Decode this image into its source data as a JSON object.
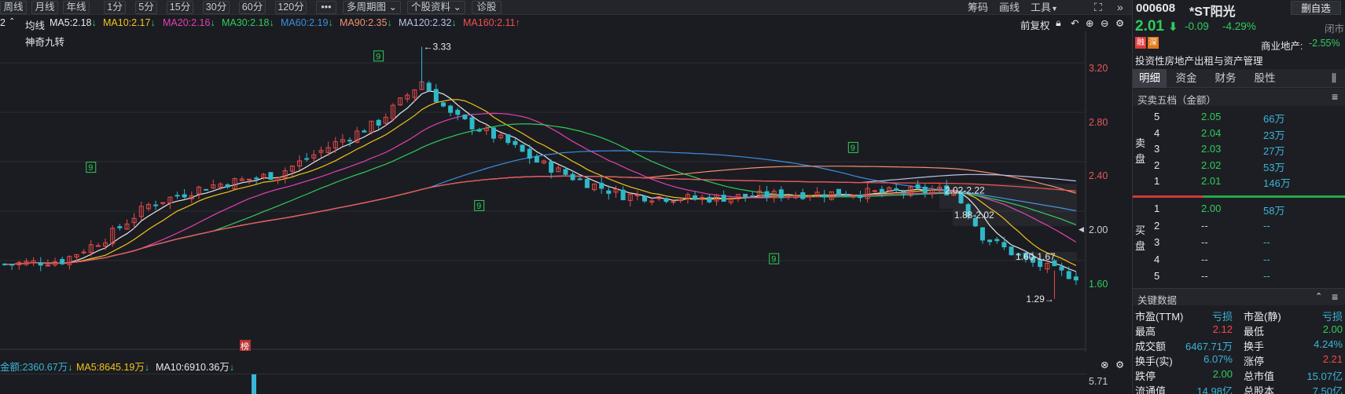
{
  "toolbar": {
    "items": [
      "周线",
      "月线",
      "年线",
      "1分",
      "5分",
      "15分",
      "30分",
      "60分",
      "120分",
      "•••",
      "多周期图",
      "个股资料",
      "诊股"
    ],
    "right_items": [
      "筹码",
      "画线",
      "工具"
    ],
    "fullscreen_icon": "expand-icon",
    "collapse_icon": "double-chevron-right-icon"
  },
  "ma_row": {
    "prefix": "2",
    "prefix_arrow": "^",
    "avg_label": "均线",
    "items": [
      {
        "text": "MA5:2.18",
        "arrow": "↓",
        "color": "#e6e8ec"
      },
      {
        "text": "MA10:2.17",
        "arrow": "↓",
        "color": "#f0c419"
      },
      {
        "text": "MA20:2.16",
        "arrow": "↓",
        "color": "#e040b0"
      },
      {
        "text": "MA30:2.18",
        "arrow": "↓",
        "color": "#2ecc5b"
      },
      {
        "text": "MA60:2.19",
        "arrow": "↓",
        "color": "#3a8fe0"
      },
      {
        "text": "MA90:2.35",
        "arrow": "↓",
        "color": "#f09070"
      },
      {
        "text": "MA120:2.32",
        "arrow": "↓",
        "color": "#b8c0e8"
      },
      {
        "text": "MA160:2.11",
        "arrow": "↑",
        "color": "#f05050"
      }
    ],
    "fuquan": "前复权"
  },
  "chart": {
    "indicator_label": "神奇九转",
    "y_ticks": [
      "3.20",
      "2.80",
      "2.40",
      "2.00",
      "1.60"
    ],
    "annotations": {
      "high": "←3.33",
      "low": "1.29→",
      "zone1": "2.02-2.22",
      "zone2": "1.88-2.02",
      "zone3": "1.60-1.67"
    },
    "tag_bang": "榜",
    "nine_marker": "9"
  },
  "chart_data": {
    "type": "candlestick",
    "title": "",
    "y_ticks": [
      3.2,
      2.8,
      2.4,
      2.0,
      1.6
    ],
    "ylim": [
      1.25,
      3.45
    ],
    "high": 3.33,
    "low": 1.29,
    "series": [
      {
        "name": "MA5",
        "last": 2.18
      },
      {
        "name": "MA10",
        "last": 2.17
      },
      {
        "name": "MA20",
        "last": 2.16
      },
      {
        "name": "MA30",
        "last": 2.18
      },
      {
        "name": "MA60",
        "last": 2.19
      },
      {
        "name": "MA90",
        "last": 2.35
      },
      {
        "name": "MA120",
        "last": 2.32
      },
      {
        "name": "MA160",
        "last": 2.11
      }
    ]
  },
  "volume": {
    "items": [
      {
        "text": "金额:2360.67万",
        "arrow": "↓",
        "color": "#38b6d8"
      },
      {
        "text": "MA5:8645.19万",
        "arrow": "↓",
        "color": "#f0c419"
      },
      {
        "text": "MA10:6910.36万",
        "arrow": "↓",
        "color": "#e6e8ec"
      }
    ],
    "tick": "5.71"
  },
  "stock": {
    "code": "000608",
    "name": "*ST阳光",
    "delete_btn": "删自选",
    "price": "2.01",
    "change": "-0.09",
    "change_pct": "-4.29%",
    "status": "闭市",
    "badge_rz": "融",
    "badge_shen": "深",
    "industry": "商业地产:",
    "industry_pct": "-2.55%",
    "business": "投资性房地产出租与资产管理"
  },
  "tabs": [
    "明细",
    "资金",
    "财务",
    "股性"
  ],
  "orderbook": {
    "title": "买卖五档（金额）",
    "sell_label": "卖盘",
    "buy_label": "买盘",
    "sells": [
      {
        "level": "5",
        "price": "2.05",
        "amount": "66万"
      },
      {
        "level": "4",
        "price": "2.04",
        "amount": "23万"
      },
      {
        "level": "3",
        "price": "2.03",
        "amount": "27万"
      },
      {
        "level": "2",
        "price": "2.02",
        "amount": "53万"
      },
      {
        "level": "1",
        "price": "2.01",
        "amount": "146万"
      }
    ],
    "buys": [
      {
        "level": "1",
        "price": "2.00",
        "amount": "58万"
      },
      {
        "level": "2",
        "price": "--",
        "amount": "--"
      },
      {
        "level": "3",
        "price": "--",
        "amount": "--"
      },
      {
        "level": "4",
        "price": "--",
        "amount": "--"
      },
      {
        "level": "5",
        "price": "--",
        "amount": "--"
      }
    ]
  },
  "keydata": {
    "title": "关键数据",
    "rows": [
      {
        "l1": "市盈(TTM)",
        "v1": "亏损",
        "c1": "#38b6d8",
        "l2": "市盈(静)",
        "v2": "亏损",
        "c2": "#38b6d8"
      },
      {
        "l1": "最高",
        "v1": "2.12",
        "c1": "#f04848",
        "l2": "最低",
        "v2": "2.00",
        "c2": "#2ecc5b"
      },
      {
        "l1": "成交额",
        "v1": "6467.71万",
        "c1": "#38b6d8",
        "l2": "换手",
        "v2": "4.24%",
        "c2": "#38b6d8"
      },
      {
        "l1": "换手(实)",
        "v1": "6.07%",
        "c1": "#38b6d8",
        "l2": "涨停",
        "v2": "2.21",
        "c2": "#f04848"
      },
      {
        "l1": "跌停",
        "v1": "2.00",
        "c1": "#2ecc5b",
        "l2": "总市值",
        "v2": "15.07亿",
        "c2": "#38b6d8"
      },
      {
        "l1": "流通值",
        "v1": "14.98亿",
        "c1": "#38b6d8",
        "l2": "总股本",
        "v2": "7.50亿",
        "c2": "#38b6d8"
      }
    ]
  }
}
